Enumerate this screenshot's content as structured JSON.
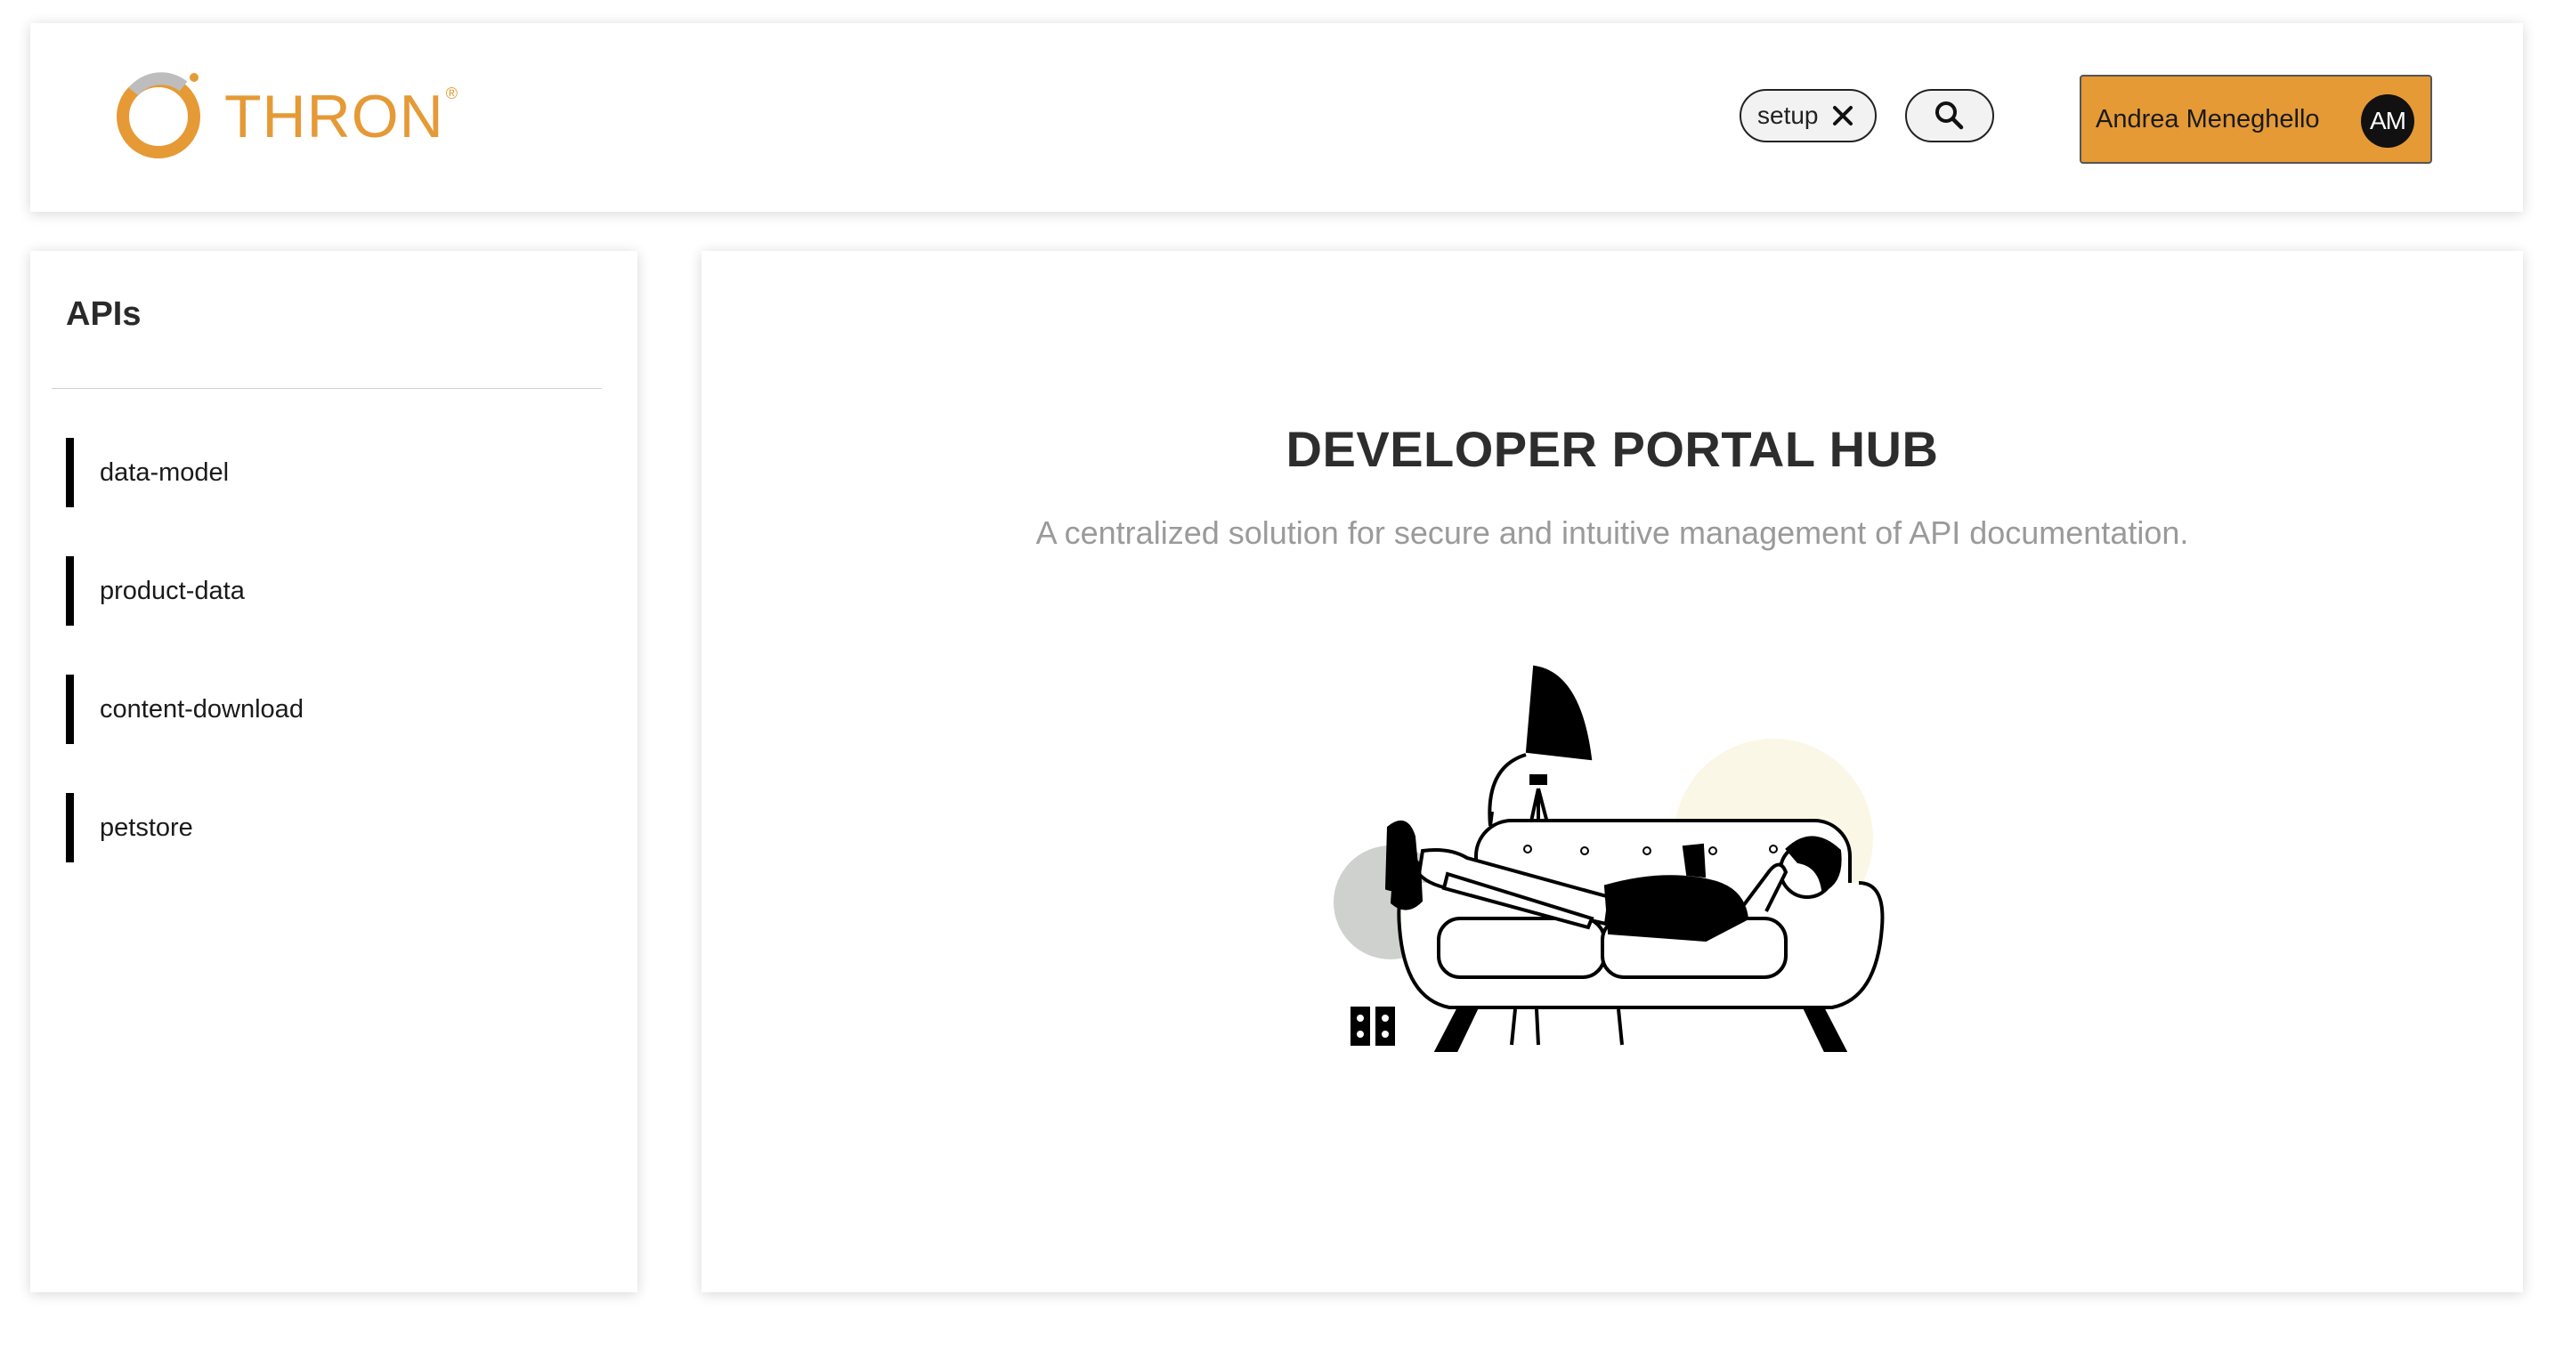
{
  "header": {
    "logo_text": "THRON",
    "logo_mark": "®",
    "search_chip_label": "setup",
    "user_name": "Andrea Meneghello",
    "user_initials": "AM",
    "accent_color": "#e59a36"
  },
  "sidebar": {
    "title": "APIs",
    "items": [
      {
        "label": "data-model"
      },
      {
        "label": "product-data"
      },
      {
        "label": "content-download"
      },
      {
        "label": "petstore"
      }
    ]
  },
  "main": {
    "title": "DEVELOPER PORTAL HUB",
    "subtitle": "A centralized solution for secure and intuitive management of API documentation.",
    "illustration": "man-relaxing-on-sofa"
  },
  "icons": {
    "logo": "thron-ring-logo",
    "clear_search": "close-icon",
    "search": "search-icon",
    "avatar": "avatar"
  }
}
